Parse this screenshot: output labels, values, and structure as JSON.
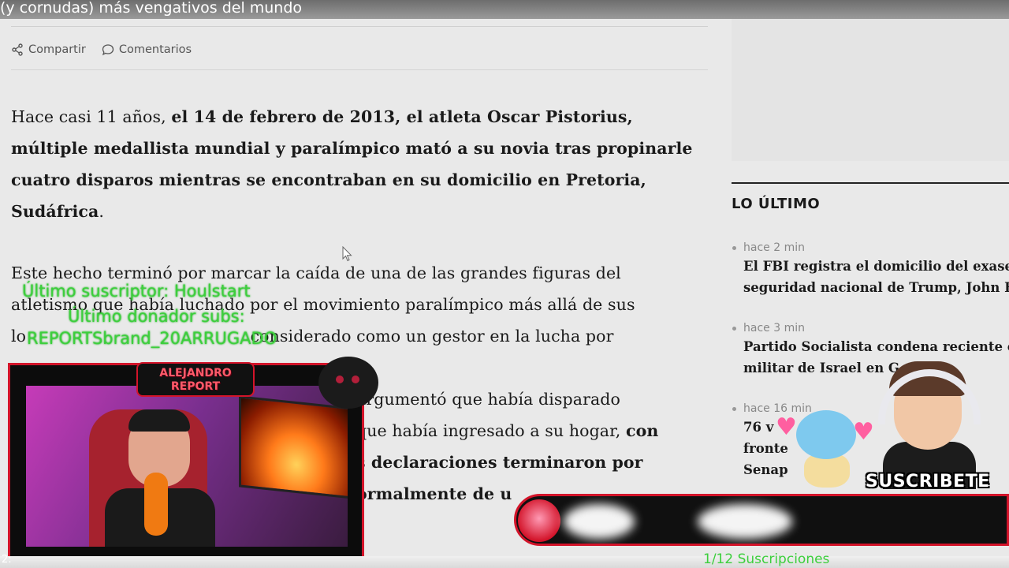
{
  "window": {
    "title": "(y cornudas) más vengativos del mundo"
  },
  "share_bar": {
    "share_label": "Compartir",
    "comments_label": "Comentarios"
  },
  "article": {
    "p1_lead": "Hace casi 11 años, ",
    "p1_bold": "el 14 de febrero de 2013, el atleta Oscar Pistorius, múltiple medallista mundial y paralímpico mató a su novia tras propinarle cuatro disparos mientras se encontraban en su domicilio en Pretoria, Sudáfrica",
    "p1_end": ".",
    "p2_line1": "Este hecho terminó por marcar la caída de una de las grandes figuras del",
    "p2_line2": "atletismo que había luchado por el movimiento paralímpico más allá de sus",
    "p2_line3": "lo                                           considerado como un gestor en la lucha por",
    "p3_line1": "argumentó que había disparado",
    "p3_line2_a": "que había ingresado a su hogar, ",
    "p3_line2_b": "con",
    "p3_line3": "s declaraciones terminaron por",
    "p3_line4": "ormalmente de u"
  },
  "sidebar": {
    "heading": "LO ÚLTIMO",
    "items": [
      {
        "time": "hace 2 min",
        "line1": "El FBI registra el domicilio del exases",
        "line2": "seguridad nacional de Trump, John B"
      },
      {
        "time": "hace 3 min",
        "line1": "Partido Socialista condena reciente o",
        "line2": "militar de Israel en G        a “lim"
      },
      {
        "time": "hace 16 min",
        "line1": "76 v",
        "line2": "fronte",
        "line3": "Senap"
      }
    ]
  },
  "overlay": {
    "last_subscriber": "Último suscriptor: Houlstart",
    "last_donor": "Último donador subs:",
    "donor_name": "REPORTSbrand_20ARRUGADO",
    "badge_line1": "ALEJANDRO",
    "badge_line2": "REPORT",
    "subscribe_text": "SUSCRIBETE",
    "sub_goal": "1/12 Suscripciones",
    "time_left": "2:"
  },
  "colors": {
    "overlay_red": "#d3142a",
    "overlay_green": "#3ccf3c"
  }
}
